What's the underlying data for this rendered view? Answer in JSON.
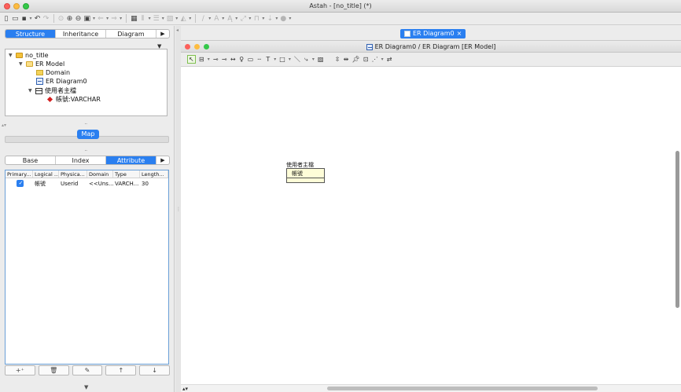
{
  "window": {
    "title": "Astah - [no_title] (*)"
  },
  "toolbar": {
    "buttons": [
      "new",
      "open",
      "save",
      "undo",
      "redo",
      "zoom-in",
      "zoom-out",
      "fit",
      "back",
      "forward",
      "grid",
      "align",
      "layer",
      "color",
      "font",
      "style",
      "line",
      "more"
    ]
  },
  "left_panel": {
    "tabs": [
      "Structure",
      "Inheritance",
      "Diagram"
    ],
    "active_tab": "Structure",
    "more": "▶",
    "tree": [
      {
        "label": "no_title",
        "level": 0,
        "icon": "project-folder-icon",
        "expanded": true
      },
      {
        "label": "ER Model",
        "level": 1,
        "icon": "model-folder-icon",
        "expanded": true
      },
      {
        "label": "Domain",
        "level": 2,
        "icon": "domain-icon",
        "expanded": false
      },
      {
        "label": "ER Diagram0",
        "level": 2,
        "icon": "er-diagram-icon",
        "expanded": false
      },
      {
        "label": "使用者主檔",
        "level": 2,
        "icon": "entity-icon",
        "expanded": true
      },
      {
        "label": "帳號:VARCHAR",
        "level": 3,
        "icon": "primary-key-icon",
        "expanded": false
      }
    ],
    "map_label": "Map",
    "prop_tabs": [
      "Base",
      "Index",
      "Attribute"
    ],
    "active_prop_tab": "Attribute",
    "attr_table": {
      "headers": [
        "Primary...",
        "Logical ...",
        "Physica...",
        "Domain",
        "Type",
        "Length..."
      ],
      "rows": [
        {
          "primary": true,
          "logical": "帳號",
          "physical": "Userid",
          "domain": "<<Uns...",
          "type": "VARCH...",
          "length": "30"
        }
      ]
    },
    "attr_buttons": [
      "add",
      "delete",
      "edit",
      "move-up",
      "move-down"
    ]
  },
  "diagram": {
    "doc_tab": "ER Diagram0",
    "inner_title": "ER Diagram0 / ER Diagram [ER Model]",
    "entity": {
      "name": "使用者主檔",
      "attribute": "帳號"
    }
  },
  "colors": {
    "accent": "#2a7ff0",
    "entity_fill": "#fefdd8"
  }
}
